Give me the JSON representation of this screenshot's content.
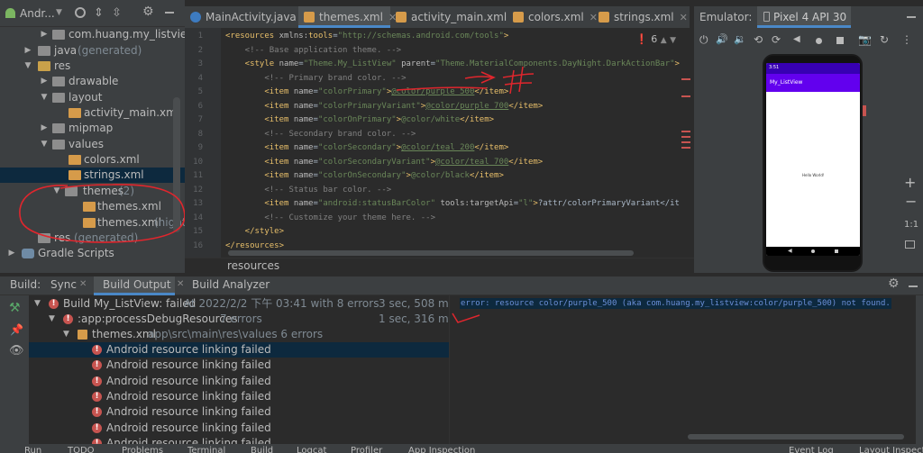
{
  "project": {
    "title": "Andr...",
    "tree": [
      {
        "label": "com.huang.my_listview",
        "extra": ""
      },
      {
        "label": "java",
        "extra": "(generated)"
      },
      {
        "label": "res",
        "extra": ""
      },
      {
        "label": "drawable",
        "extra": ""
      },
      {
        "label": "layout",
        "extra": ""
      },
      {
        "label": "activity_main.xml",
        "extra": ""
      },
      {
        "label": "mipmap",
        "extra": ""
      },
      {
        "label": "values",
        "extra": ""
      },
      {
        "label": "colors.xml",
        "extra": ""
      },
      {
        "label": "strings.xml",
        "extra": ""
      },
      {
        "label": "themes",
        "extra": "(2)"
      },
      {
        "label": "themes.xml",
        "extra": ""
      },
      {
        "label": "themes.xml",
        "extra": "(night"
      },
      {
        "label": "res",
        "extra": "(generated)"
      },
      {
        "label": "Gradle Scripts",
        "extra": ""
      }
    ]
  },
  "tabs": [
    {
      "label": "MainActivity.java"
    },
    {
      "label": "themes.xml"
    },
    {
      "label": "activity_main.xml"
    },
    {
      "label": "colors.xml"
    },
    {
      "label": "strings.xml"
    }
  ],
  "editor": {
    "inspection_count": "6",
    "breadcrumb": "resources",
    "lines": [
      "1",
      "2",
      "3",
      "4",
      "5",
      "6",
      "7",
      "8",
      "9",
      "10",
      "11",
      "12",
      "13",
      "14",
      "15",
      "16"
    ],
    "code": [
      {
        "parts": [
          [
            "tg",
            "<resources "
          ],
          [
            "an",
            "xmlns:"
          ],
          [
            "tg",
            "tools"
          ],
          [
            "pl",
            "="
          ],
          [
            "av",
            "\"http://schemas.android.com/tools\""
          ],
          [
            "tg",
            ">"
          ]
        ]
      },
      {
        "parts": [
          [
            "cm",
            "    <!-- Base application theme. -->"
          ]
        ]
      },
      {
        "parts": [
          [
            "tg",
            "    <style "
          ],
          [
            "an",
            "name"
          ],
          [
            "pl",
            "="
          ],
          [
            "av",
            "\"Theme.My_ListView\" "
          ],
          [
            "an",
            "parent"
          ],
          [
            "pl",
            "="
          ],
          [
            "av",
            "\"Theme.MaterialComponents.DayNight.DarkActionBar\""
          ],
          [
            "tg",
            ">"
          ]
        ]
      },
      {
        "parts": [
          [
            "cm",
            "        <!-- Primary brand color. -->"
          ]
        ]
      },
      {
        "parts": [
          [
            "tg",
            "        <item "
          ],
          [
            "an",
            "name"
          ],
          [
            "pl",
            "="
          ],
          [
            "av",
            "\"colorPrimary\""
          ],
          [
            "tg",
            ">"
          ],
          [
            "lk",
            "@color/purple_500"
          ],
          [
            "tg",
            "</item>"
          ]
        ]
      },
      {
        "parts": [
          [
            "tg",
            "        <item "
          ],
          [
            "an",
            "name"
          ],
          [
            "pl",
            "="
          ],
          [
            "av",
            "\"colorPrimaryVariant\""
          ],
          [
            "tg",
            ">"
          ],
          [
            "lk",
            "@color/purple_700"
          ],
          [
            "tg",
            "</item>"
          ]
        ]
      },
      {
        "parts": [
          [
            "tg",
            "        <item "
          ],
          [
            "an",
            "name"
          ],
          [
            "pl",
            "="
          ],
          [
            "av",
            "\"colorOnPrimary\""
          ],
          [
            "tg",
            ">"
          ],
          [
            "av",
            "@color/white"
          ],
          [
            "tg",
            "</item>"
          ]
        ]
      },
      {
        "parts": [
          [
            "cm",
            "        <!-- Secondary brand color. -->"
          ]
        ]
      },
      {
        "parts": [
          [
            "tg",
            "        <item "
          ],
          [
            "an",
            "name"
          ],
          [
            "pl",
            "="
          ],
          [
            "av",
            "\"colorSecondary\""
          ],
          [
            "tg",
            ">"
          ],
          [
            "lk",
            "@color/teal_200"
          ],
          [
            "tg",
            "</item>"
          ]
        ]
      },
      {
        "parts": [
          [
            "tg",
            "        <item "
          ],
          [
            "an",
            "name"
          ],
          [
            "pl",
            "="
          ],
          [
            "av",
            "\"colorSecondaryVariant\""
          ],
          [
            "tg",
            ">"
          ],
          [
            "lk",
            "@color/teal_700"
          ],
          [
            "tg",
            "</item>"
          ]
        ]
      },
      {
        "parts": [
          [
            "tg",
            "        <item "
          ],
          [
            "an",
            "name"
          ],
          [
            "pl",
            "="
          ],
          [
            "av",
            "\"colorOnSecondary\""
          ],
          [
            "tg",
            ">"
          ],
          [
            "av",
            "@color/black"
          ],
          [
            "tg",
            "</item>"
          ]
        ]
      },
      {
        "parts": [
          [
            "cm",
            "        <!-- Status bar color. -->"
          ]
        ]
      },
      {
        "parts": [
          [
            "tg",
            "        <item "
          ],
          [
            "an",
            "name"
          ],
          [
            "pl",
            "="
          ],
          [
            "av",
            "\"android:statusBarColor\" "
          ],
          [
            "an",
            "tools:targetApi"
          ],
          [
            "pl",
            "="
          ],
          [
            "av",
            "\"l\""
          ],
          [
            "tg",
            ">"
          ],
          [
            "pl",
            "?attr/colorPrimaryVariant</it"
          ]
        ]
      },
      {
        "parts": [
          [
            "cm",
            "        <!-- Customize your theme here. -->"
          ]
        ]
      },
      {
        "parts": [
          [
            "tg",
            "    </style>"
          ]
        ]
      },
      {
        "parts": [
          [
            "tg",
            "</resources>"
          ]
        ]
      }
    ]
  },
  "emulator": {
    "label": "Emulator:",
    "device": "Pixel 4 API 30",
    "app_title": "My_ListView",
    "status_time": "3:51",
    "center_text": "Hello World!",
    "zoom_label": "1:1"
  },
  "build": {
    "tab_label": "Build:",
    "tabs": [
      "Sync",
      "Build Output",
      "Build Analyzer"
    ],
    "rows": [
      {
        "label": "Build My_ListView: failed",
        "extra": "At 2022/2/2 下午 03:41 with 8 errors",
        "time": "3 sec, 508 ms"
      },
      {
        "label": ":app:processDebugResources",
        "extra": "7 errors",
        "time": "1 sec, 316 ms"
      },
      {
        "label": "themes.xml",
        "extra": "app\\src\\main\\res\\values 6 errors",
        "time": ""
      },
      {
        "label": "Android resource linking failed",
        "extra": "",
        "time": ""
      },
      {
        "label": "Android resource linking failed",
        "extra": "",
        "time": ""
      },
      {
        "label": "Android resource linking failed",
        "extra": "",
        "time": ""
      },
      {
        "label": "Android resource linking failed",
        "extra": "",
        "time": ""
      },
      {
        "label": "Android resource linking failed",
        "extra": "",
        "time": ""
      },
      {
        "label": "Android resource linking failed",
        "extra": "",
        "time": ""
      },
      {
        "label": "Android resource linking failed",
        "extra": "",
        "time": ""
      }
    ],
    "output": "error: resource color/purple_500 (aka com.huang.my_listview:color/purple_500) not found."
  },
  "statusbar": [
    "Run",
    "TODO",
    "Problems",
    "Terminal",
    "Build",
    "Logcat",
    "Profiler",
    "App Inspection",
    "Event Log",
    "Layout Inspector"
  ],
  "colors": {
    "accent": "#4a88c7",
    "error": "#c75450",
    "annotation": "#e0262d",
    "app_bar": "#6200ee"
  }
}
